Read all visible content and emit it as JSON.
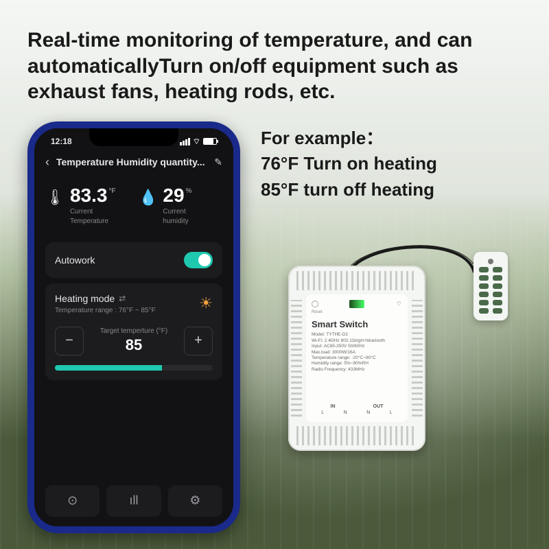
{
  "headline": "Real-time monitoring of temperature, and can automaticallyTurn on/off equipment such as exhaust fans, heating rods, etc.",
  "example": {
    "title": "For example：",
    "line1": "76°F   Turn on heating",
    "line2": "85°F   turn off  heating"
  },
  "phone": {
    "status": {
      "time": "12:18"
    },
    "titlebar": {
      "title": "Temperature Humidity quantity..."
    },
    "metrics": {
      "temperature": {
        "icon": "🌡",
        "value": "83.3",
        "unit": "°F",
        "label1": "Current",
        "label2": "Temperature"
      },
      "humidity": {
        "icon": "💧",
        "value": "29",
        "unit": "%",
        "label1": "Current",
        "label2": "humidity"
      }
    },
    "autowork": {
      "label": "Autowork",
      "on": true
    },
    "mode": {
      "title": "Heating mode",
      "range": "Temperature range : 76°F ~ 85°F",
      "target_label": "Target temperture  (°F)",
      "target_value": "85",
      "minus": "−",
      "plus": "+"
    },
    "nav": {
      "a": "⊙",
      "b": "ıll",
      "c": "⚙"
    }
  },
  "device": {
    "brand": "Smart Switch",
    "reset": "Reset",
    "specs": {
      "model": "Model: TYTHE-D2",
      "wifi": "Wi-Fi: 2.4GHz 802.11b/g/n+bluetooth",
      "input": "Input: AC85-250V 50/60Hz",
      "load": "Max.load: 3000W/16A",
      "temp": "Temperature range: -20°C~80°C",
      "hum": "Humidity range: 5%~90%RH",
      "rf": "Radio Frequency: 433MHz"
    },
    "io": {
      "in": "IN",
      "out": "OUT",
      "l": "L",
      "n": "N"
    }
  }
}
